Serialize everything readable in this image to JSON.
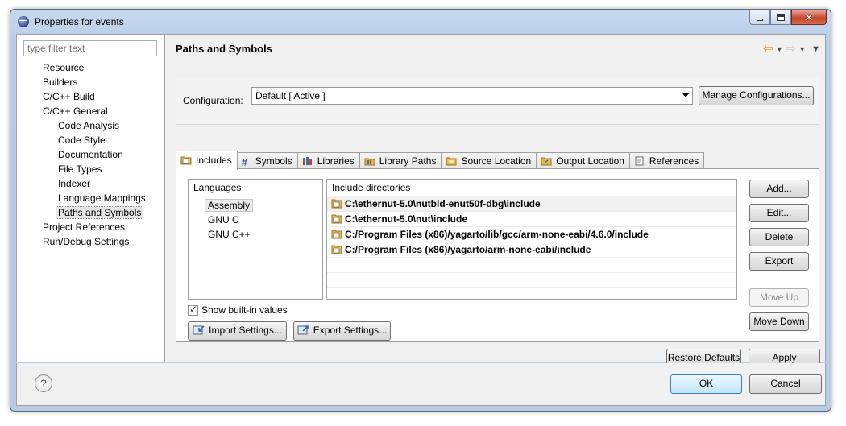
{
  "window": {
    "title": "Properties for events"
  },
  "filter": {
    "placeholder": "type filter text"
  },
  "tree": [
    {
      "label": "Resource",
      "level": 1
    },
    {
      "label": "Builders",
      "level": 1
    },
    {
      "label": "C/C++ Build",
      "level": 1
    },
    {
      "label": "C/C++ General",
      "level": 1
    },
    {
      "label": "Code Analysis",
      "level": 2
    },
    {
      "label": "Code Style",
      "level": 2
    },
    {
      "label": "Documentation",
      "level": 2
    },
    {
      "label": "File Types",
      "level": 2
    },
    {
      "label": "Indexer",
      "level": 2
    },
    {
      "label": "Language Mappings",
      "level": 2
    },
    {
      "label": "Paths and Symbols",
      "level": 2,
      "selected": true
    },
    {
      "label": "Project References",
      "level": 1
    },
    {
      "label": "Run/Debug Settings",
      "level": 1
    }
  ],
  "page": {
    "title": "Paths and Symbols",
    "configuration_label": "Configuration:",
    "configuration_value": "Default  [ Active ]",
    "manage_button": "Manage Configurations..."
  },
  "tabs": [
    {
      "label": "Includes",
      "icon": "includes-icon",
      "active": true
    },
    {
      "label": "Symbols",
      "icon": "hash-icon"
    },
    {
      "label": "Libraries",
      "icon": "libraries-icon"
    },
    {
      "label": "Library Paths",
      "icon": "library-paths-icon"
    },
    {
      "label": "Source Location",
      "icon": "source-folder-icon"
    },
    {
      "label": "Output Location",
      "icon": "output-folder-icon"
    },
    {
      "label": "References",
      "icon": "references-icon"
    }
  ],
  "languages": {
    "header": "Languages",
    "items": [
      "Assembly",
      "GNU C",
      "GNU C++"
    ],
    "selected": "Assembly"
  },
  "includes": {
    "header": "Include directories",
    "rows": [
      "C:\\ethernut-5.0\\nutbld-enut50f-dbg\\include",
      "C:\\ethernut-5.0\\nut\\include",
      "C:/Program Files (x86)/yagarto/lib/gcc/arm-none-eabi/4.6.0/include",
      "C:/Program Files (x86)/yagarto/arm-none-eabi/include"
    ]
  },
  "side_buttons": {
    "add": "Add...",
    "edit": "Edit...",
    "delete": "Delete",
    "export": "Export",
    "move_up": "Move Up",
    "move_down": "Move Down"
  },
  "show_builtin": {
    "label": "Show built-in values",
    "checked": true
  },
  "import_settings": "Import Settings...",
  "export_settings": "Export Settings...",
  "restore_defaults": "Restore Defaults",
  "apply": "Apply",
  "ok": "OK",
  "cancel": "Cancel",
  "help_glyph": "?",
  "colors": {
    "accent": "#3c7fb1",
    "folder": "#e8b84a",
    "nav_back": "#e3a21a"
  }
}
